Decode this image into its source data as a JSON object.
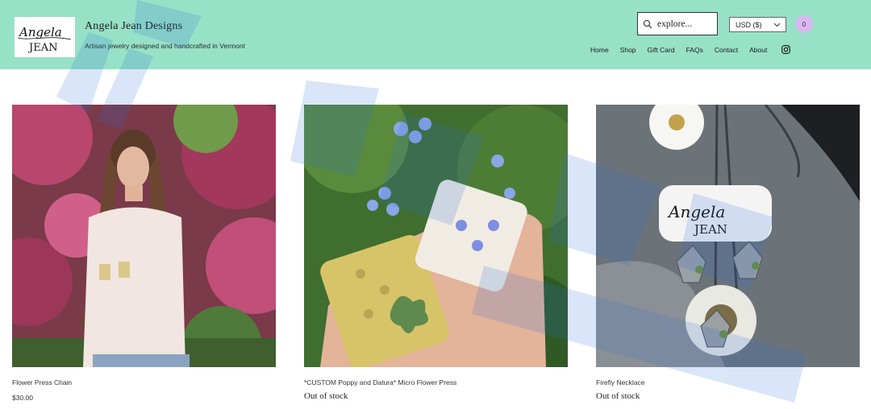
{
  "header": {
    "logo_line1": "Angela",
    "logo_line2": "JEAN",
    "title": "Angela Jean Designs",
    "tagline": "Artisan jewelry designed and handcrafted in Vermont",
    "search_placeholder": "explore...",
    "currency": "USD ($)",
    "cart_count": "0",
    "nav": [
      "Home",
      "Shop",
      "Gift Card",
      "FAQs",
      "Contact",
      "About"
    ]
  },
  "products": [
    {
      "name": "Flower Press Chain",
      "price": "$30.00",
      "stock": ""
    },
    {
      "name": "*CUSTOM Poppy and Datura* Micro Flower Press",
      "price": "",
      "stock": "Out of stock"
    },
    {
      "name": "Firefly Necklace",
      "price": "",
      "stock": "Out of stock"
    }
  ],
  "colors": {
    "header_bg": "#97e1c7",
    "cart_badge": "#d9b8f0",
    "watermark": "#2f6fd6"
  }
}
